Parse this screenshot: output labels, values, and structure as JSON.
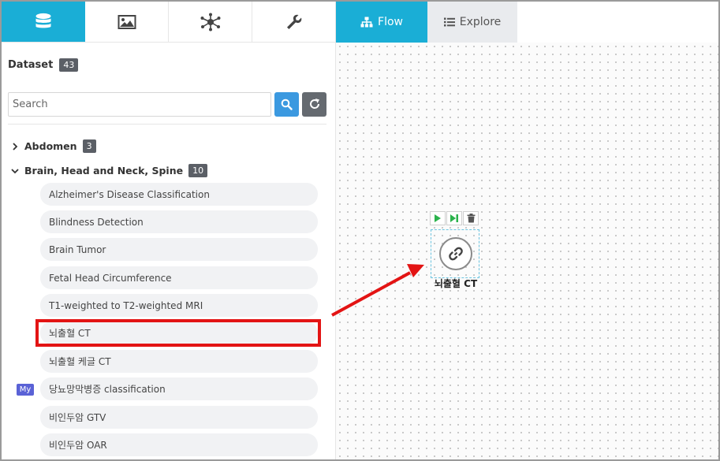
{
  "left_tabs": [
    {
      "icon": "database-icon",
      "active": true
    },
    {
      "icon": "image-icon",
      "active": false
    },
    {
      "icon": "network-icon",
      "active": false
    },
    {
      "icon": "wrench-icon",
      "active": false
    }
  ],
  "sidebar": {
    "title": "Dataset",
    "count": "43",
    "search": {
      "placeholder": "Search",
      "value": ""
    },
    "groups": [
      {
        "label": "Abdomen",
        "count": "3",
        "expanded": false
      },
      {
        "label": "Brain, Head and Neck, Spine",
        "count": "10",
        "expanded": true
      }
    ],
    "items": [
      {
        "label": "Alzheimer's Disease Classification"
      },
      {
        "label": "Blindness Detection"
      },
      {
        "label": "Brain Tumor"
      },
      {
        "label": "Fetal Head Circumference"
      },
      {
        "label": "T1-weighted to T2-weighted MRI"
      },
      {
        "label": "뇌출혈 CT"
      },
      {
        "label": "뇌출혈 케글 CT"
      },
      {
        "label": "당뇨망막병증 classification",
        "badge": "My"
      },
      {
        "label": "비인두암 GTV"
      },
      {
        "label": "비인두암 OAR"
      }
    ]
  },
  "right_tabs": {
    "flow": "Flow",
    "explore": "Explore"
  },
  "canvas": {
    "node": {
      "label": "뇌출혈 CT",
      "icon": "link-icon"
    },
    "annotation_color": "#e31414"
  },
  "colors": {
    "accent": "#1aaed6",
    "search_button": "#3b99e0",
    "refresh_button": "#656a70",
    "my_badge": "#5a62d6",
    "play_green": "#2bb24c"
  }
}
